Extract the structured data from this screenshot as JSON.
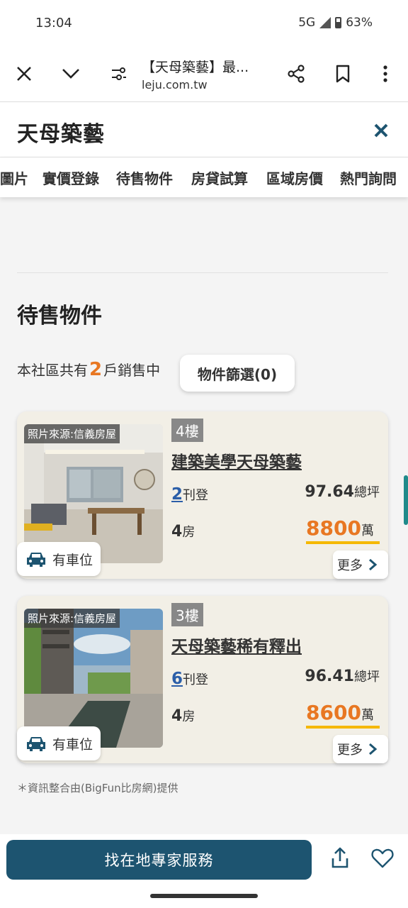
{
  "status_bar": {
    "time": "13:04",
    "network": "5G",
    "battery": "63%"
  },
  "browser": {
    "page_title": "【天母築藝】最...",
    "url": "leju.com.tw"
  },
  "site": {
    "title": "天母築藝"
  },
  "tabs": [
    "圖片",
    "實價登錄",
    "待售物件",
    "房貸試算",
    "區域房價",
    "熱門詢問"
  ],
  "section": {
    "title": "待售物件",
    "count_prefix": "本社區共有",
    "count": "2",
    "count_suffix": "戶銷售中",
    "filter_label": "物件篩選(0)"
  },
  "listings": [
    {
      "photo_label": "照片來源:信義房屋",
      "parking": "有車位",
      "floor": "4樓",
      "title": "建築美學天母築藝",
      "published": "2",
      "published_unit": "刊登",
      "area": "97.64",
      "area_unit": "總坪",
      "rooms": "4",
      "rooms_unit": "房",
      "price": "8800",
      "price_unit": "萬",
      "more": "更多"
    },
    {
      "photo_label": "照片來源:信義房屋",
      "parking": "有車位",
      "floor": "3樓",
      "title": "天母築藝稀有釋出",
      "published": "6",
      "published_unit": "刊登",
      "area": "96.41",
      "area_unit": "總坪",
      "rooms": "4",
      "rooms_unit": "房",
      "price": "8600",
      "price_unit": "萬",
      "more": "更多"
    }
  ],
  "footnote": "＊資訊整合由(BigFun比房網)提供",
  "bottom": {
    "cta_label": "找在地專家服務"
  },
  "colors": {
    "accent_orange": "#e87722",
    "cta_blue": "#1d5470",
    "link_blue": "#2b5ea8",
    "price_underline": "#f5b800"
  }
}
